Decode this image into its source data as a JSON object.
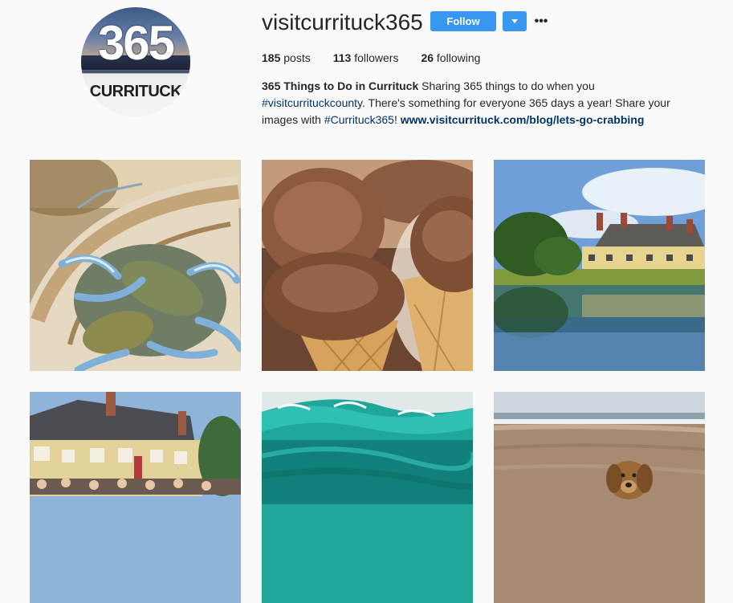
{
  "profile": {
    "username": "visitcurrituck365",
    "avatar_big": "365",
    "avatar_small": "CURRITUCK",
    "follow_label": "Follow",
    "more_label": "•••",
    "stats": {
      "posts_count": "185",
      "posts_label": "posts",
      "followers_count": "113",
      "followers_label": "followers",
      "following_count": "26",
      "following_label": "following"
    },
    "bio": {
      "name": "365 Things to Do in Currituck",
      "text1": " Sharing 365 things to do when you ",
      "hashtag1": "#visitcurrituckcounty",
      "text2": ". There's something for everyone 365 days a year! Share your images with ",
      "hashtag2": "#Currituck365",
      "text3": "! ",
      "link": "www.visitcurrituck.com/blog/lets-go-crabbing"
    }
  },
  "posts": [
    {
      "subject": "blue crabs in a bushel basket"
    },
    {
      "subject": "chocolate ice cream cones"
    },
    {
      "subject": "historic lodge with reflection on water"
    },
    {
      "subject": "yellow historic building with crowd"
    },
    {
      "subject": "aerial view of turquoise surf"
    },
    {
      "subject": "dog digging on sandy beach"
    }
  ],
  "colors": {
    "accent": "#3897f0",
    "link": "#003569",
    "background": "#fafafa"
  }
}
